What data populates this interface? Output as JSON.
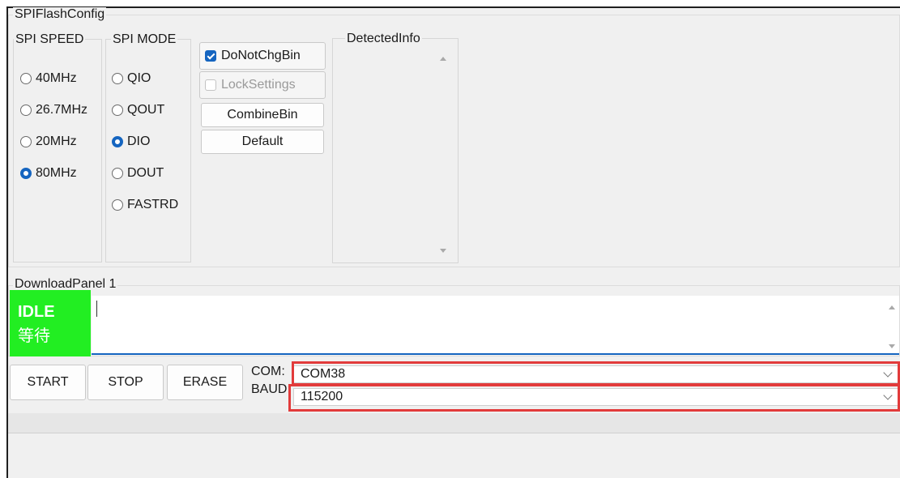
{
  "spi_config": {
    "title": "SPIFlashConfig",
    "speed": {
      "title": "SPI SPEED",
      "options": [
        {
          "label": "40MHz",
          "selected": false
        },
        {
          "label": "26.7MHz",
          "selected": false
        },
        {
          "label": "20MHz",
          "selected": false
        },
        {
          "label": "80MHz",
          "selected": true
        }
      ]
    },
    "mode": {
      "title": "SPI MODE",
      "options": [
        {
          "label": "QIO",
          "selected": false
        },
        {
          "label": "QOUT",
          "selected": false
        },
        {
          "label": "DIO",
          "selected": true
        },
        {
          "label": "DOUT",
          "selected": false
        },
        {
          "label": "FASTRD",
          "selected": false
        }
      ]
    },
    "do_not_chg_bin": {
      "label": "DoNotChgBin",
      "checked": true
    },
    "lock_settings": {
      "label": "LockSettings",
      "checked": false
    },
    "combine_bin_label": "CombineBin",
    "default_label": "Default",
    "detected_info": {
      "title": "DetectedInfo",
      "text": ""
    }
  },
  "download_panel": {
    "title": "DownloadPanel 1",
    "status": {
      "line1": "IDLE",
      "line2": "等待",
      "color": "#22ee22"
    },
    "log_text": "",
    "start_label": "START",
    "stop_label": "STOP",
    "erase_label": "ERASE",
    "com": {
      "label": "COM:",
      "value": "COM38"
    },
    "baud": {
      "label": "BAUD:",
      "value": "115200"
    }
  },
  "accent_color": "#1565c0",
  "highlight_color": "#e23b3b"
}
